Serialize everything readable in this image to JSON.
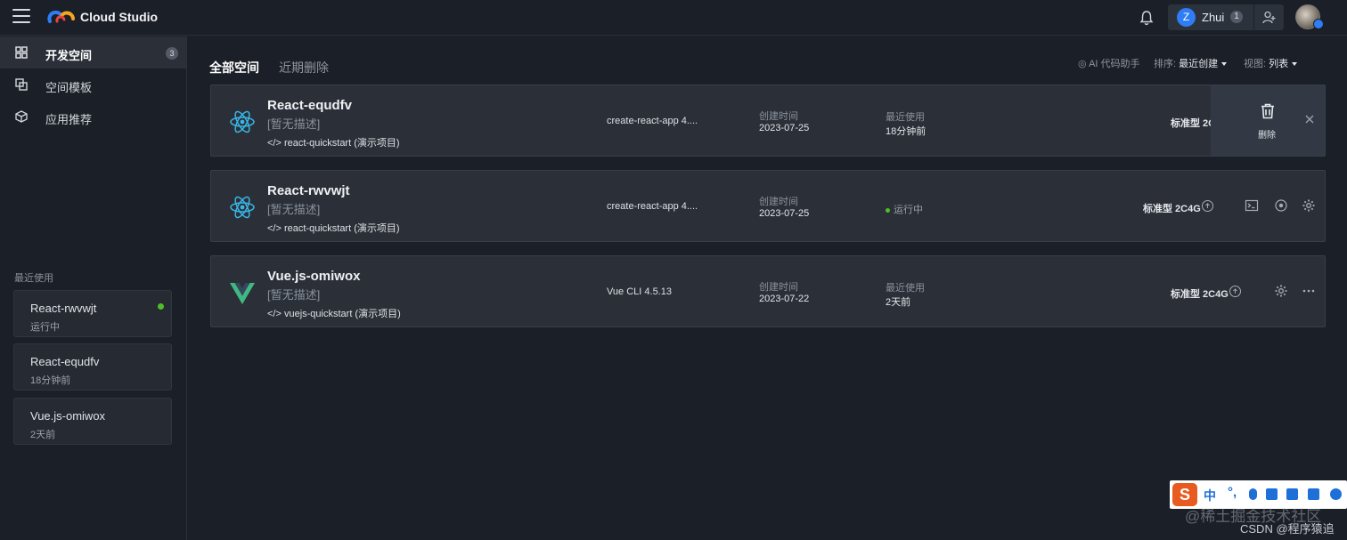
{
  "header": {
    "brand": "Cloud Studio",
    "user_initial": "Z",
    "user_name": "Zhui",
    "user_count": "1"
  },
  "sidebar": {
    "items": [
      {
        "label": "开发空间",
        "badge": "3",
        "icon": "grid-icon"
      },
      {
        "label": "空间模板",
        "icon": "template-icon"
      },
      {
        "label": "应用推荐",
        "icon": "cube-icon"
      }
    ],
    "recent_title": "最近使用",
    "recent": [
      {
        "name": "React-rwvwjt",
        "sub": "运行中"
      },
      {
        "name": "React-equdfv",
        "sub": "18分钟前"
      },
      {
        "name": "Vue.js-omiwox",
        "sub": "2天前"
      }
    ]
  },
  "main": {
    "tabs": [
      "全部空间",
      "近期删除"
    ],
    "ai_label": "AI 代码助手",
    "sort_label": "排序:",
    "sort_value": "最近创建",
    "view_label": "视图:",
    "view_value": "列表"
  },
  "workspaces": [
    {
      "title": "React-equdfv",
      "desc": "[暂无描述]",
      "repo": "</> react-quickstart (演示项目)",
      "template": "create-react-app 4....",
      "created_label": "创建时间",
      "created": "2023-07-25",
      "last_label": "最近使用",
      "last": "18分钟前",
      "spec": "标准型 2C",
      "delete_label": "删除",
      "icon": "react-icon"
    },
    {
      "title": "React-rwvwjt",
      "desc": "[暂无描述]",
      "repo": "</> react-quickstart (演示项目)",
      "template": "create-react-app 4....",
      "created_label": "创建时间",
      "created": "2023-07-25",
      "status": "运行中",
      "spec": "标准型 2C4G",
      "icon": "react-icon"
    },
    {
      "title": "Vue.js-omiwox",
      "desc": "[暂无描述]",
      "repo": "</> vuejs-quickstart (演示项目)",
      "template": "Vue CLI 4.5.13",
      "created_label": "创建时间",
      "created": "2023-07-22",
      "last_label": "最近使用",
      "last": "2天前",
      "spec": "标准型 2C4G",
      "icon": "vue-icon"
    }
  ],
  "ime": {
    "zh": "中",
    "punct": "°,"
  },
  "watermark": {
    "line1": "@稀土掘金技术社区",
    "line2": "CSDN @程序猿追"
  },
  "colors": {
    "accent": "#2f7df5",
    "running": "#4fbf26",
    "react": "#38b6e8",
    "vue": "#41b883"
  }
}
